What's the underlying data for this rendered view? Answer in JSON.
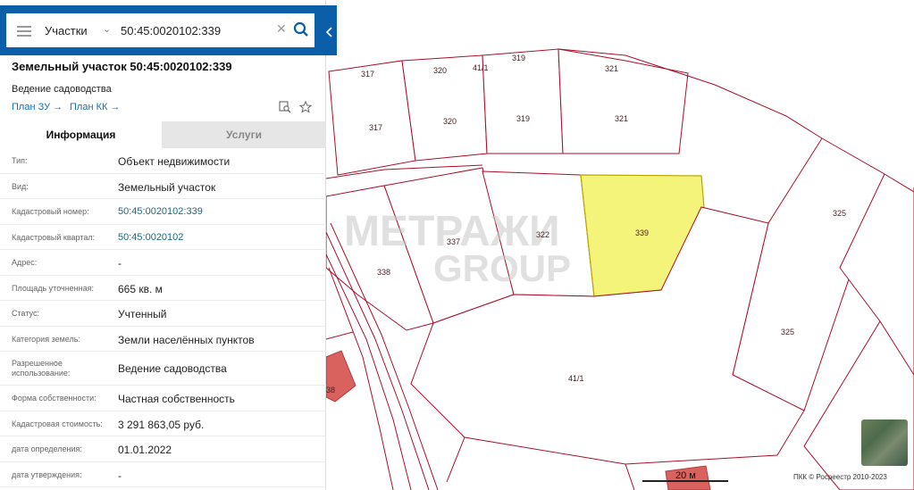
{
  "search": {
    "type_label": "Участки",
    "query": "50:45:0020102:339"
  },
  "header": {
    "title": "Земельный участок 50:45:0020102:339",
    "purpose": "Ведение садоводства",
    "plan_zu": "План ЗУ →",
    "plan_kk": "План КК →"
  },
  "tabs": {
    "info": "Информация",
    "services": "Услуги"
  },
  "properties": [
    {
      "key": "Тип:",
      "value": "Объект недвижимости",
      "link": false
    },
    {
      "key": "Вид:",
      "value": "Земельный участок",
      "link": false
    },
    {
      "key": "Кадастровый номер:",
      "value": "50:45:0020102:339",
      "link": true
    },
    {
      "key": "Кадастровый квартал:",
      "value": "50:45:0020102",
      "link": true
    },
    {
      "key": "Адрес:",
      "value": "-",
      "link": false
    },
    {
      "key": "Площадь уточненная:",
      "value": "665 кв. м",
      "link": false
    },
    {
      "key": "Статус:",
      "value": "Учтенный",
      "link": false
    },
    {
      "key": "Категория земель:",
      "value": "Земли населённых пунктов",
      "link": false
    },
    {
      "key": "Разрешенное использование:",
      "value": "Ведение садоводства",
      "link": false
    },
    {
      "key": "Форма собственности:",
      "value": "Частная собственность",
      "link": false
    },
    {
      "key": "Кадастровая стоимость:",
      "value": "3 291 863,05 руб.",
      "link": false
    },
    {
      "key": "дата определения:",
      "value": "01.01.2022",
      "link": false
    },
    {
      "key": "дата утверждения:",
      "value": "-",
      "link": false
    }
  ],
  "map": {
    "labels": {
      "p317a": "317",
      "p317b": "317",
      "p320a": "320",
      "p320b": "320",
      "p41_1a": "41/1",
      "p319a": "319",
      "p319b": "319",
      "p321a": "321",
      "p321b": "321",
      "p325a": "325",
      "p325b": "325",
      "p337": "337",
      "p322": "322",
      "p339": "339",
      "p338": "338",
      "p41_1b": "41/1",
      "p38": "38"
    },
    "watermark_top": "МЕТРАЖИ",
    "watermark_bottom": "GROUP",
    "scale": "20 м",
    "copyright": "ПКК © Росреестр 2010-2023",
    "selected_color": "#f5f47a",
    "boundary_color": "#a8102a"
  }
}
